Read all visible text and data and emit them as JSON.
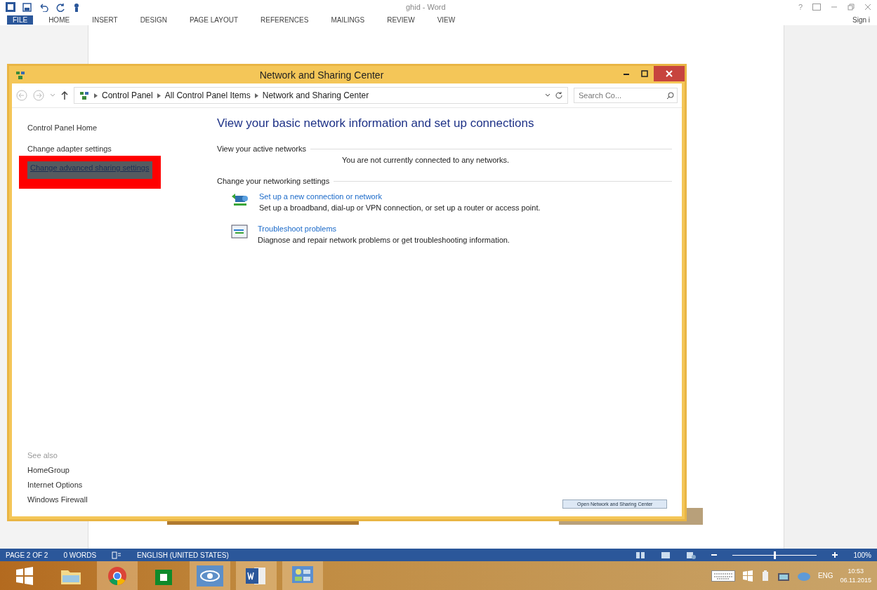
{
  "word": {
    "title": "ghid - Word",
    "help": "?",
    "sign_in": "Sign i",
    "ribbon_tabs": [
      {
        "label": "FILE",
        "selected": true
      },
      {
        "label": "HOME",
        "selected": false
      },
      {
        "label": "INSERT",
        "selected": false
      },
      {
        "label": "DESIGN",
        "selected": false
      },
      {
        "label": "PAGE LAYOUT",
        "selected": false
      },
      {
        "label": "REFERENCES",
        "selected": false
      },
      {
        "label": "MAILINGS",
        "selected": false
      },
      {
        "label": "REVIEW",
        "selected": false
      },
      {
        "label": "VIEW",
        "selected": false
      }
    ]
  },
  "window": {
    "title": "Network and Sharing Center",
    "breadcrumb": [
      "Control Panel",
      "All Control Panel Items",
      "Network and Sharing Center"
    ],
    "search": {
      "placeholder": "Search Co..."
    },
    "sidebar_links": [
      {
        "label": "Control Panel Home",
        "highlighted": false
      },
      {
        "label": "Change adapter settings",
        "highlighted": false
      },
      {
        "label": "Change advanced sharing settings",
        "highlighted": true
      }
    ],
    "heading": "View your basic network information and set up connections",
    "sections": [
      {
        "title": "View your active networks",
        "message": "You are not currently connected to any networks."
      },
      {
        "title": "Change your networking settings",
        "tasks": [
          {
            "kind": "connection",
            "title": "Set up a new connection or network",
            "description": "Set up a broadband, dial-up or VPN connection, or set up a router or access point."
          },
          {
            "kind": "troubleshoot",
            "title": "Troubleshoot problems",
            "description": "Diagnose and repair network problems or get troubleshooting information."
          }
        ]
      }
    ],
    "see_also": {
      "label": "See also",
      "links": [
        "HomeGroup",
        "Internet Options",
        "Windows Firewall"
      ]
    }
  },
  "pasted_tooltip": "Open Network and Sharing Center",
  "status_bar": {
    "page": "PAGE 2 OF 2",
    "words": "0 WORDS",
    "language": "ENGLISH (UNITED STATES)",
    "zoom": {
      "level": 0.5,
      "reading": "100%"
    }
  },
  "taskbar": {
    "apps": [
      {
        "kind": "start",
        "running": false
      },
      {
        "kind": "explorer",
        "running": false
      },
      {
        "kind": "chrome",
        "running": true
      },
      {
        "kind": "store",
        "running": false
      },
      {
        "kind": "eye",
        "running": true
      },
      {
        "kind": "word",
        "running": true
      },
      {
        "kind": "control-panel",
        "running": true
      }
    ],
    "language": "ENG",
    "time": "10:53",
    "date": "06.11.2015"
  }
}
